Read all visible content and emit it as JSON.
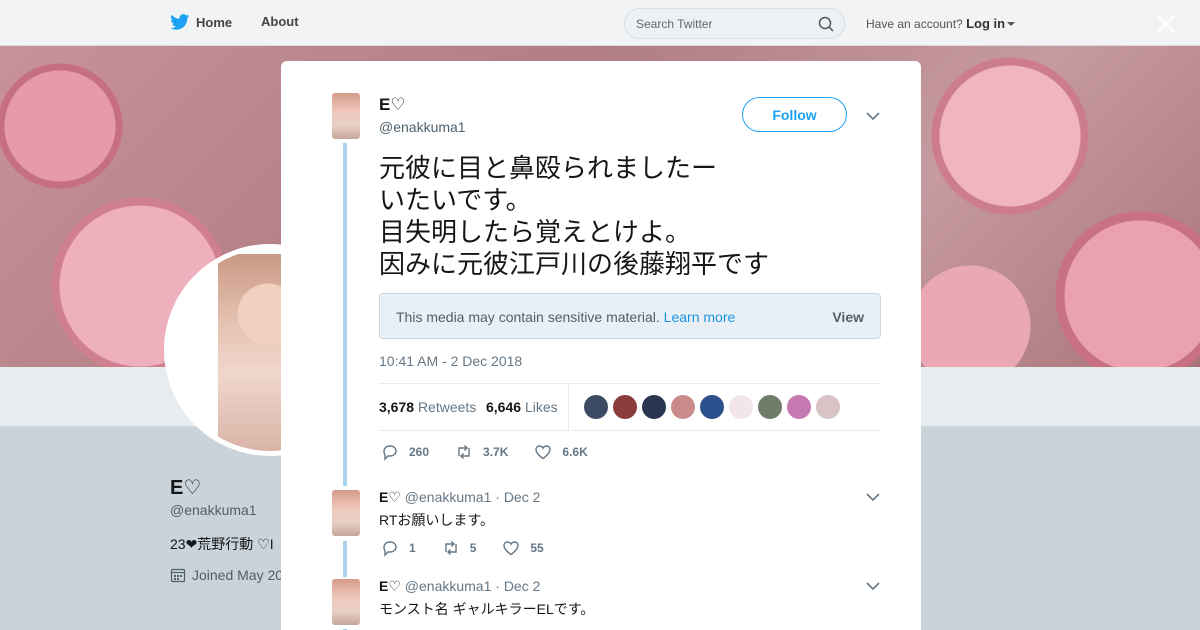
{
  "nav": {
    "home_label": "Home",
    "about_label": "About",
    "search_placeholder": "Search Twitter",
    "account_prompt": "Have an account?",
    "login_label": "Log in"
  },
  "profile": {
    "name": "E♡",
    "handle": "@enakkuma1",
    "bio": "23❤荒野行動 ♡I",
    "joined": "Joined May 20"
  },
  "tweet": {
    "author_name": "E♡",
    "author_handle": "@enakkuma1",
    "follow_label": "Follow",
    "text_lines": [
      "元彼に目と鼻殴られましたー",
      "いたいです。",
      "目失明したら覚えとけよ。",
      "因みに元彼江戸川の後藤翔平です"
    ],
    "sensitive_message": "This media may contain sensitive material.",
    "learn_more": "Learn more",
    "view_label": "View",
    "timestamp": "10:41 AM - 2 Dec 2018",
    "retweets_count": "3,678",
    "retweets_label": "Retweets",
    "likes_count": "6,646",
    "likes_label": "Likes",
    "replies": "260",
    "retweets_short": "3.7K",
    "likes_short": "6.6K"
  },
  "likers_colors": [
    "#3b4a63",
    "#8a3b3b",
    "#2b3550",
    "#c98a8a",
    "#2a4f8a",
    "#f3e6ea",
    "#6f7d6a",
    "#c47ab0",
    "#d9c3c6"
  ],
  "replies": [
    {
      "name": "E♡",
      "handle": "@enakkuma1",
      "date": "· Dec 2",
      "text": "RTお願いします。",
      "reply_count": "1",
      "retweet_count": "5",
      "like_count": "55"
    },
    {
      "name": "E♡",
      "handle": "@enakkuma1",
      "date": "· Dec 2",
      "text": "モンスト名  ギャルキラーELです。"
    }
  ]
}
